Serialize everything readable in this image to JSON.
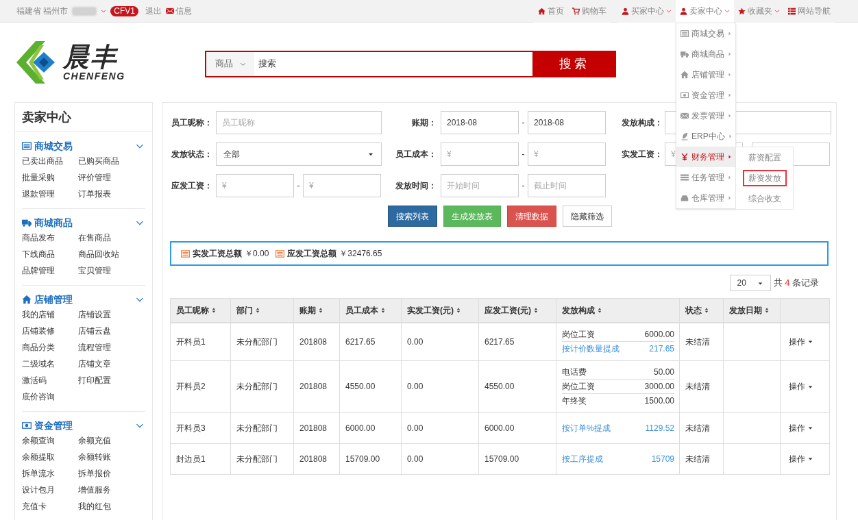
{
  "top_bar": {
    "location": "福建省 福州市",
    "badge": "CFV1",
    "logout": "退出",
    "messages": "信息",
    "links": [
      {
        "label": "首页",
        "dropdown": false,
        "expanded": false
      },
      {
        "label": "购物车",
        "dropdown": false,
        "expanded": false
      },
      {
        "label": "买家中心",
        "dropdown": true,
        "expanded": false
      },
      {
        "label": "卖家中心",
        "dropdown": true,
        "expanded": true
      },
      {
        "label": "收藏夹",
        "dropdown": true,
        "expanded": false
      },
      {
        "label": "网站导航",
        "dropdown": false,
        "expanded": false
      }
    ]
  },
  "seller_menu": {
    "items": [
      {
        "label": "商城交易",
        "selected": false
      },
      {
        "label": "商城商品",
        "selected": false
      },
      {
        "label": "店铺管理",
        "selected": false
      },
      {
        "label": "资金管理",
        "selected": false
      },
      {
        "label": "发票管理",
        "selected": false
      },
      {
        "label": "ERP中心",
        "selected": false
      },
      {
        "label": "财务管理",
        "selected": true
      },
      {
        "label": "任务管理",
        "selected": false
      },
      {
        "label": "仓库管理",
        "selected": false
      }
    ],
    "submenu": [
      {
        "label": "薪资配置",
        "selected": false
      },
      {
        "label": "薪资发放",
        "selected": true
      },
      {
        "label": "综合收支",
        "selected": false
      }
    ]
  },
  "logo": {
    "name": "晨丰",
    "latin": "CHENFENG"
  },
  "search": {
    "category": "商品",
    "placeholder": "搜索",
    "button": "搜索"
  },
  "sidebar": {
    "title": "卖家中心",
    "sections": [
      {
        "title": "商城交易",
        "items": [
          "已卖出商品",
          "已购买商品",
          "批量采购",
          "评价管理",
          "退款管理",
          "订单报表"
        ]
      },
      {
        "title": "商城商品",
        "items": [
          "商品发布",
          "在售商品",
          "下线商品",
          "商品回收站",
          "品牌管理",
          "宝贝管理"
        ]
      },
      {
        "title": "店铺管理",
        "items": [
          "我的店铺",
          "店铺设置",
          "店铺装修",
          "店铺云盘",
          "商品分类",
          "流程管理",
          "二级域名",
          "店铺文章",
          "激活码",
          "打印配置",
          "底价咨询"
        ]
      },
      {
        "title": "资金管理",
        "items": [
          "余额查询",
          "余额充值",
          "余额提取",
          "余额转账",
          "拆单流水",
          "拆单报价",
          "设计包月",
          "增值服务",
          "充值卡",
          "我的红包"
        ]
      }
    ]
  },
  "filters": [
    [
      {
        "label": "员工昵称：",
        "kind": "text",
        "placeholder": "员工昵称"
      },
      {
        "label": "账期：",
        "kind": "range",
        "separator": "-",
        "fields": [
          {
            "value": "2018-08"
          },
          {
            "value": "2018-08"
          }
        ]
      },
      {
        "label": "发放构成：",
        "kind": "text"
      }
    ],
    [
      {
        "label": "发放状态：",
        "kind": "select",
        "value": "全部"
      },
      {
        "label": "员工成本：",
        "kind": "range",
        "separator": "-",
        "fields": [
          {
            "placeholder": "¥"
          },
          {
            "placeholder": "¥"
          }
        ]
      },
      {
        "label": "实发工资：",
        "kind": "range",
        "fields": [
          {
            "placeholder": "¥"
          }
        ]
      }
    ],
    [
      {
        "label": "应发工资：",
        "kind": "range",
        "separator": "-",
        "fields": [
          {
            "placeholder": "¥"
          },
          {
            "placeholder": "¥"
          }
        ]
      },
      {
        "label": "发放时间：",
        "kind": "range",
        "separator": "-",
        "fields": [
          {
            "placeholder": "开始时间"
          },
          {
            "placeholder": "截止时间"
          }
        ]
      }
    ]
  ],
  "actions": [
    {
      "label": "搜索列表",
      "kind": "primary"
    },
    {
      "label": "生成发放表",
      "kind": "success"
    },
    {
      "label": "清理数据",
      "kind": "danger"
    },
    {
      "label": "隐藏筛选",
      "kind": "default"
    }
  ],
  "summary": [
    {
      "label": "实发工资总额",
      "value": "￥0.00"
    },
    {
      "label": "应发工资总额",
      "value": "￥32476.65"
    }
  ],
  "pagination": {
    "page_size": "20",
    "prefix": "共",
    "count": "4",
    "suffix": "条记录"
  },
  "table": {
    "columns": [
      {
        "label": "员工昵称",
        "sortable": true
      },
      {
        "label": "部门",
        "sortable": true
      },
      {
        "label": "账期",
        "sortable": true
      },
      {
        "label": "员工成本",
        "sortable": true
      },
      {
        "label": "实发工资(元)",
        "sortable": true
      },
      {
        "label": "应发工资(元)",
        "sortable": true
      },
      {
        "label": "发放构成",
        "sortable": true
      },
      {
        "label": "状态",
        "sortable": true
      },
      {
        "label": "发放日期",
        "sortable": true
      },
      {
        "sortable": false
      }
    ],
    "rows": [
      {
        "name": "开料员1",
        "department": "未分配部门",
        "period": "201808",
        "cost": "6217.65",
        "paid": "0.00",
        "payable": "6217.65",
        "composition": [
          {
            "label": "岗位工资",
            "amount": "6000.00",
            "kind": "plain"
          },
          {
            "label": "按计价数量提成",
            "amount": "217.65",
            "kind": "link"
          }
        ],
        "status": "未结清",
        "action": "操作"
      },
      {
        "name": "开料员2",
        "department": "未分配部门",
        "period": "201808",
        "cost": "4550.00",
        "paid": "0.00",
        "payable": "4550.00",
        "composition": [
          {
            "label": "电话费",
            "amount": "50.00",
            "kind": "plain"
          },
          {
            "label": "岗位工资",
            "amount": "3000.00",
            "kind": "plain"
          },
          {
            "label": "年终奖",
            "amount": "1500.00",
            "kind": "plain"
          }
        ],
        "status": "未结清",
        "action": "操作"
      },
      {
        "name": "开料员3",
        "department": "未分配部门",
        "period": "201808",
        "cost": "6000.00",
        "paid": "0.00",
        "payable": "6000.00",
        "composition": [
          {
            "label": "按订单%提成",
            "amount": "1129.52",
            "kind": "link"
          }
        ],
        "status": "未结清",
        "action": "操作"
      },
      {
        "name": "封边员1",
        "department": "未分配部门",
        "period": "201808",
        "cost": "15709.00",
        "paid": "0.00",
        "payable": "15709.00",
        "composition": [
          {
            "label": "按工序提成",
            "amount": "15709",
            "kind": "link"
          }
        ],
        "status": "未结清",
        "action": "操作"
      }
    ]
  }
}
